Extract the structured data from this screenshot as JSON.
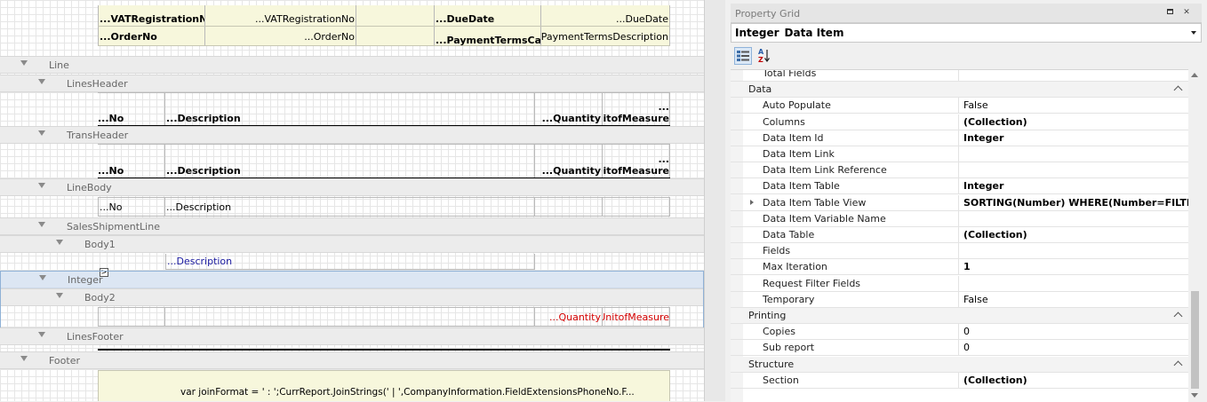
{
  "designer": {
    "header_rows": [
      {
        "left_label": "...VATRegistrationNo",
        "left_value": "...VATRegistrationNo",
        "right_label": "...DueDate",
        "right_value": "...DueDate"
      },
      {
        "left_label": "...OrderNo",
        "left_value": "...OrderNo",
        "right_label": "...PaymentTermsCaption",
        "right_value": "...PaymentTermsDescription"
      }
    ],
    "bands": {
      "line": "Line",
      "lines_header": "LinesHeader",
      "trans_header": "TransHeader",
      "line_body": "LineBody",
      "sales_shipment_line": "SalesShipmentLine",
      "body1": "Body1",
      "integer": "Integer",
      "body2": "Body2",
      "lines_footer": "LinesFooter",
      "footer": "Footer"
    },
    "lines_header_cells": {
      "no": "...No",
      "description": "...Description",
      "quantity": "...Quantity",
      "uom": "...UnitofMeasure",
      "uom_ellipsis": "..."
    },
    "trans_header_cells": {
      "no": "...No",
      "description": "...Description",
      "quantity": "...Quantity",
      "uom": "...UnitofMeasure",
      "uom_ellipsis": "..."
    },
    "line_body_cells": {
      "no": "...No",
      "description": "...Description"
    },
    "body1_cells": {
      "description": "...Description"
    },
    "body2_cells": {
      "quantity": "...Quantity",
      "uom": "...UnitofMeasure"
    },
    "smart_tag": ">",
    "footer_expression": "var joinFormat = ' : ';CurrReport.JoinStrings(' | ',CompanyInformation.FieldExtensionsPhoneNo.F..."
  },
  "property_grid": {
    "title": "Property Grid",
    "selected_object_type": "Integer",
    "selected_object_name": "Data Item",
    "rows": [
      {
        "kind": "prop",
        "name": "Total Fields",
        "value": ""
      },
      {
        "kind": "cat",
        "name": "Data"
      },
      {
        "kind": "prop",
        "name": "Auto Populate",
        "value": "False"
      },
      {
        "kind": "prop",
        "name": "Columns",
        "value": "(Collection)",
        "bold": true
      },
      {
        "kind": "prop",
        "name": "Data Item Id",
        "value": "Integer",
        "bold": true
      },
      {
        "kind": "prop",
        "name": "Data Item Link",
        "value": ""
      },
      {
        "kind": "prop",
        "name": "Data Item Link Reference",
        "value": ""
      },
      {
        "kind": "prop",
        "name": "Data Item Table",
        "value": "Integer",
        "bold": true
      },
      {
        "kind": "prop",
        "name": "Data Item Table View",
        "value": "SORTING(Number) WHERE(Number=FILTE...",
        "bold": true,
        "expandable": true
      },
      {
        "kind": "prop",
        "name": "Data Item Variable Name",
        "value": ""
      },
      {
        "kind": "prop",
        "name": "Data Table",
        "value": "(Collection)",
        "bold": true
      },
      {
        "kind": "prop",
        "name": "Fields",
        "value": ""
      },
      {
        "kind": "prop",
        "name": "Max Iteration",
        "value": "1",
        "bold": true
      },
      {
        "kind": "prop",
        "name": "Request Filter Fields",
        "value": ""
      },
      {
        "kind": "prop",
        "name": "Temporary",
        "value": "False"
      },
      {
        "kind": "cat",
        "name": "Printing"
      },
      {
        "kind": "prop",
        "name": "Copies",
        "value": "0"
      },
      {
        "kind": "prop",
        "name": "Sub report",
        "value": "0"
      },
      {
        "kind": "cat",
        "name": "Structure"
      },
      {
        "kind": "prop",
        "name": "Section",
        "value": "(Collection)",
        "bold": true
      }
    ]
  },
  "colors": {
    "accent": "#a9c2de",
    "error_text": "#d40000",
    "link_text": "#1a1aa0",
    "yellow_cell": "#f7f7dc"
  }
}
